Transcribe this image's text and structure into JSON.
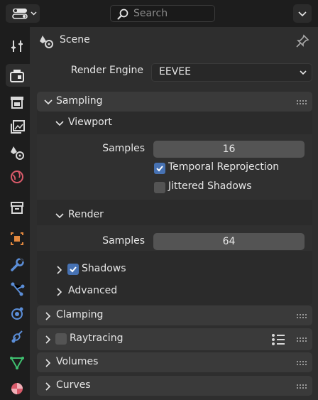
{
  "header": {
    "search_placeholder": "Search",
    "editor_icon": "properties-editor-icon",
    "options_icon": "chevron-down-icon"
  },
  "tabs": [
    {
      "name": "tool",
      "icon": "tool-icon"
    },
    {
      "name": "render",
      "icon": "render-icon",
      "active": true
    },
    {
      "name": "output",
      "icon": "output-icon"
    },
    {
      "name": "view-layer",
      "icon": "view-layer-icon"
    },
    {
      "name": "scene",
      "icon": "scene-icon"
    },
    {
      "name": "world",
      "icon": "world-icon"
    },
    {
      "name": "collection",
      "icon": "collection-icon"
    },
    {
      "name": "object",
      "icon": "object-icon"
    },
    {
      "name": "modifiers",
      "icon": "wrench-icon"
    },
    {
      "name": "particles",
      "icon": "particles-icon"
    },
    {
      "name": "physics",
      "icon": "physics-icon"
    },
    {
      "name": "constraints",
      "icon": "constraints-icon"
    },
    {
      "name": "data",
      "icon": "mesh-data-icon"
    },
    {
      "name": "material",
      "icon": "material-icon"
    }
  ],
  "context": {
    "label": "Scene",
    "pin_icon": "pin-icon"
  },
  "render_engine": {
    "label": "Render Engine",
    "value": "EEVEE"
  },
  "sampling": {
    "title": "Sampling",
    "viewport": {
      "title": "Viewport",
      "samples_label": "Samples",
      "samples_value": "16",
      "temporal_reprojection": {
        "label": "Temporal Reprojection",
        "checked": true
      },
      "jittered_shadows": {
        "label": "Jittered Shadows",
        "checked": false
      }
    },
    "render": {
      "title": "Render",
      "samples_label": "Samples",
      "samples_value": "64"
    },
    "shadows": {
      "title": "Shadows",
      "checked": true
    },
    "advanced": {
      "title": "Advanced"
    }
  },
  "panels": {
    "clamping": "Clamping",
    "raytracing": "Raytracing",
    "volumes": "Volumes",
    "curves": "Curves"
  },
  "colors": {
    "accent": "#4772b3",
    "panel_header": "#3a3a3a",
    "field": "#545454"
  }
}
